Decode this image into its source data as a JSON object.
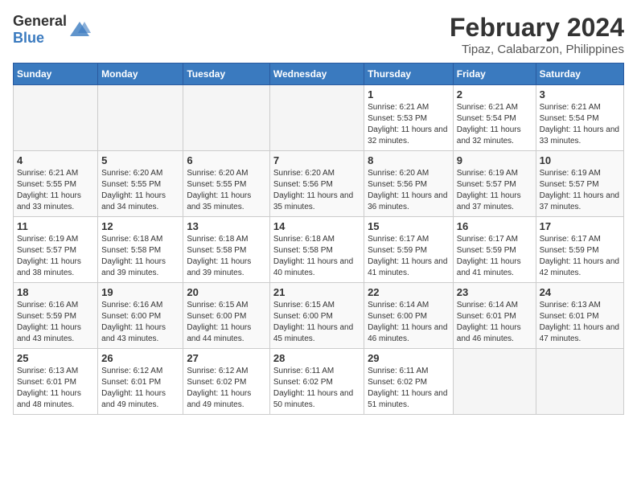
{
  "logo": {
    "general": "General",
    "blue": "Blue"
  },
  "title": "February 2024",
  "subtitle": "Tipaz, Calabarzon, Philippines",
  "days_of_week": [
    "Sunday",
    "Monday",
    "Tuesday",
    "Wednesday",
    "Thursday",
    "Friday",
    "Saturday"
  ],
  "weeks": [
    [
      {
        "day": "",
        "info": ""
      },
      {
        "day": "",
        "info": ""
      },
      {
        "day": "",
        "info": ""
      },
      {
        "day": "",
        "info": ""
      },
      {
        "day": "1",
        "sunrise": "6:21 AM",
        "sunset": "5:53 PM",
        "daylight": "11 hours and 32 minutes."
      },
      {
        "day": "2",
        "sunrise": "6:21 AM",
        "sunset": "5:54 PM",
        "daylight": "11 hours and 32 minutes."
      },
      {
        "day": "3",
        "sunrise": "6:21 AM",
        "sunset": "5:54 PM",
        "daylight": "11 hours and 33 minutes."
      }
    ],
    [
      {
        "day": "4",
        "sunrise": "6:21 AM",
        "sunset": "5:55 PM",
        "daylight": "11 hours and 33 minutes."
      },
      {
        "day": "5",
        "sunrise": "6:20 AM",
        "sunset": "5:55 PM",
        "daylight": "11 hours and 34 minutes."
      },
      {
        "day": "6",
        "sunrise": "6:20 AM",
        "sunset": "5:55 PM",
        "daylight": "11 hours and 35 minutes."
      },
      {
        "day": "7",
        "sunrise": "6:20 AM",
        "sunset": "5:56 PM",
        "daylight": "11 hours and 35 minutes."
      },
      {
        "day": "8",
        "sunrise": "6:20 AM",
        "sunset": "5:56 PM",
        "daylight": "11 hours and 36 minutes."
      },
      {
        "day": "9",
        "sunrise": "6:19 AM",
        "sunset": "5:57 PM",
        "daylight": "11 hours and 37 minutes."
      },
      {
        "day": "10",
        "sunrise": "6:19 AM",
        "sunset": "5:57 PM",
        "daylight": "11 hours and 37 minutes."
      }
    ],
    [
      {
        "day": "11",
        "sunrise": "6:19 AM",
        "sunset": "5:57 PM",
        "daylight": "11 hours and 38 minutes."
      },
      {
        "day": "12",
        "sunrise": "6:18 AM",
        "sunset": "5:58 PM",
        "daylight": "11 hours and 39 minutes."
      },
      {
        "day": "13",
        "sunrise": "6:18 AM",
        "sunset": "5:58 PM",
        "daylight": "11 hours and 39 minutes."
      },
      {
        "day": "14",
        "sunrise": "6:18 AM",
        "sunset": "5:58 PM",
        "daylight": "11 hours and 40 minutes."
      },
      {
        "day": "15",
        "sunrise": "6:17 AM",
        "sunset": "5:59 PM",
        "daylight": "11 hours and 41 minutes."
      },
      {
        "day": "16",
        "sunrise": "6:17 AM",
        "sunset": "5:59 PM",
        "daylight": "11 hours and 41 minutes."
      },
      {
        "day": "17",
        "sunrise": "6:17 AM",
        "sunset": "5:59 PM",
        "daylight": "11 hours and 42 minutes."
      }
    ],
    [
      {
        "day": "18",
        "sunrise": "6:16 AM",
        "sunset": "5:59 PM",
        "daylight": "11 hours and 43 minutes."
      },
      {
        "day": "19",
        "sunrise": "6:16 AM",
        "sunset": "6:00 PM",
        "daylight": "11 hours and 43 minutes."
      },
      {
        "day": "20",
        "sunrise": "6:15 AM",
        "sunset": "6:00 PM",
        "daylight": "11 hours and 44 minutes."
      },
      {
        "day": "21",
        "sunrise": "6:15 AM",
        "sunset": "6:00 PM",
        "daylight": "11 hours and 45 minutes."
      },
      {
        "day": "22",
        "sunrise": "6:14 AM",
        "sunset": "6:00 PM",
        "daylight": "11 hours and 46 minutes."
      },
      {
        "day": "23",
        "sunrise": "6:14 AM",
        "sunset": "6:01 PM",
        "daylight": "11 hours and 46 minutes."
      },
      {
        "day": "24",
        "sunrise": "6:13 AM",
        "sunset": "6:01 PM",
        "daylight": "11 hours and 47 minutes."
      }
    ],
    [
      {
        "day": "25",
        "sunrise": "6:13 AM",
        "sunset": "6:01 PM",
        "daylight": "11 hours and 48 minutes."
      },
      {
        "day": "26",
        "sunrise": "6:12 AM",
        "sunset": "6:01 PM",
        "daylight": "11 hours and 49 minutes."
      },
      {
        "day": "27",
        "sunrise": "6:12 AM",
        "sunset": "6:02 PM",
        "daylight": "11 hours and 49 minutes."
      },
      {
        "day": "28",
        "sunrise": "6:11 AM",
        "sunset": "6:02 PM",
        "daylight": "11 hours and 50 minutes."
      },
      {
        "day": "29",
        "sunrise": "6:11 AM",
        "sunset": "6:02 PM",
        "daylight": "11 hours and 51 minutes."
      },
      {
        "day": "",
        "info": ""
      },
      {
        "day": "",
        "info": ""
      }
    ]
  ]
}
